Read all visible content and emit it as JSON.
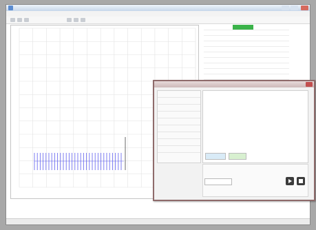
{
  "window": {
    "title": ""
  },
  "menubar": {
    "items": [
      "",
      "",
      "",
      "",
      ""
    ]
  },
  "toolbar": {
    "tools": [
      "tool-icon",
      "tool-icon",
      "tool-icon",
      "tool-icon",
      "tool-icon",
      "tool-icon"
    ]
  },
  "plot": {
    "label_left": "",
    "label_right": "",
    "x_tick_labels": [
      "",
      "",
      "",
      "",
      "",
      "",
      "",
      "",
      "",
      "",
      "",
      "",
      ""
    ],
    "waveform_color": "#6f6ff0"
  },
  "side_table": {
    "rows": [
      [
        "",
        "",
        "",
        "",
        ""
      ],
      [
        "",
        "",
        "",
        "",
        ""
      ],
      [
        "",
        "",
        "",
        "",
        ""
      ],
      [
        "",
        "",
        "",
        "",
        ""
      ],
      [
        "",
        "",
        "",
        "",
        ""
      ],
      [
        "",
        "",
        "",
        "",
        ""
      ],
      [
        "",
        "",
        "",
        "",
        ""
      ],
      [
        "",
        "",
        "",
        "",
        ""
      ],
      [
        "",
        "",
        "",
        "",
        ""
      ],
      [
        "",
        "",
        "",
        "",
        ""
      ],
      [
        "",
        "",
        "",
        "",
        ""
      ]
    ],
    "selected_color": "#3bb34a"
  },
  "info": {
    "line1": "",
    "line2": ""
  },
  "status": {
    "text": ""
  },
  "dialog": {
    "title": "",
    "left_rows": [
      "",
      "",
      "",
      "",
      "",
      "",
      "",
      "",
      ""
    ],
    "text_lines": [
      "",
      "",
      ""
    ],
    "tab_a": "",
    "tab_b": "",
    "input_value": ""
  },
  "colors": {
    "window_bg": "#ffffff",
    "desktop_bg": "#a8a8a8",
    "dialog_border": "#8e6a6a"
  }
}
